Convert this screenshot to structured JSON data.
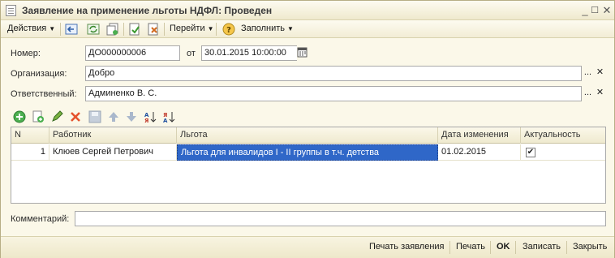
{
  "window": {
    "title": "Заявление на применение льготы НДФЛ: Проведен",
    "minimize": "_",
    "restore": "☐",
    "close": "✕"
  },
  "toolbar": {
    "actions_label": "Действия",
    "goto_label": "Перейти",
    "fill_label": "Заполнить",
    "icons": [
      "back-arrow-icon",
      "refresh-icon",
      "copy-icon",
      "post-document-icon",
      "unpost-document-icon",
      "help-icon"
    ]
  },
  "form": {
    "number_label": "Номер:",
    "number_value": "ДО000000006",
    "date_prefix": "от",
    "date_value": "30.01.2015 10:00:00",
    "org_label": "Организация:",
    "org_value": "Добро",
    "resp_label": "Ответственный:",
    "resp_value": "Админенко В. С.",
    "select_btn": "...",
    "clear_btn": "✕",
    "comment_label": "Комментарий:",
    "comment_value": ""
  },
  "table": {
    "columns": [
      "N",
      "Работник",
      "Льгота",
      "Дата изменения",
      "Актуальность"
    ],
    "rows": [
      {
        "n": "1",
        "employee": "Клюев Сергей Петрович",
        "benefit": "Льгота для инвалидов I - II группы в т.ч. детства",
        "date": "01.02.2015",
        "actual": "✔"
      }
    ]
  },
  "bottom": {
    "print_statement": "Печать заявления",
    "print": "Печать",
    "ok": "OK",
    "save": "Записать",
    "close": "Закрыть"
  }
}
